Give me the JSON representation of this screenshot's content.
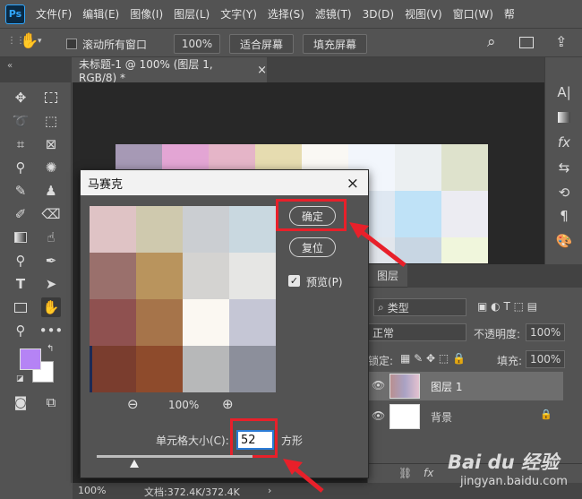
{
  "menubar": {
    "logo": "Ps",
    "items": [
      "文件(F)",
      "编辑(E)",
      "图像(I)",
      "图层(L)",
      "文字(Y)",
      "选择(S)",
      "滤镜(T)",
      "3D(D)",
      "视图(V)",
      "窗口(W)"
    ],
    "overflow": "帮"
  },
  "options": {
    "scroll_all_label": "滚动所有窗口",
    "zoom_value": "100%",
    "fit_screen": "适合屏幕",
    "fill_screen": "填充屏幕"
  },
  "tab": {
    "title": "未标题-1 @ 100% (图层 1, RGB/8) *",
    "close": "×"
  },
  "dialog": {
    "title": "马赛克",
    "close": "×",
    "ok_label": "确定",
    "reset_label": "复位",
    "preview_label": "预览(P)",
    "preview_checked": true,
    "zoom_level": "100%",
    "cell_size_label": "单元格大小(C):",
    "cell_size_value": "52",
    "unit_label": "方形",
    "slider_fraction": 0.24,
    "preview_colors": [
      "#dfc3c5",
      "#cfc9ae",
      "#cbced2",
      "#c9d8e0",
      "#9a706c",
      "#b9945d",
      "#d4d3d1",
      "#e6e6e4",
      "#8f5150",
      "#a6744a",
      "#fbf8f2",
      "#c5c6d5",
      "#7a3d2e",
      "#8e4b2c",
      "#b7b8b9",
      "#8c8f9b"
    ]
  },
  "canvas": {
    "row1_colors": [
      "#a699b5",
      "#e3a5d4",
      "#e5b5c8",
      "#e6dcb0",
      "#faf8f4",
      "#f2f6fc",
      "#ebeff1",
      "#dee2cc"
    ],
    "row2_colors": [
      "#ffffff",
      "#ffffff",
      "#ffffff",
      "#ffffff",
      "#ffffff",
      "#dfe8f2",
      "#bfe2f7",
      "#ececf2"
    ],
    "row3_colors": [
      "#ffffff",
      "#ffffff",
      "#ffffff",
      "#ffffff",
      "#ffffff",
      "#e2e6ec",
      "#c8d6e3",
      "#f0f6dc"
    ]
  },
  "layers": {
    "tab_label": "图层",
    "kind_label": "类型",
    "blend_mode": "正常",
    "opacity_label": "不透明度:",
    "opacity_value": "100%",
    "lock_label": "锁定:",
    "fill_label": "填充:",
    "fill_value": "100%",
    "items": [
      {
        "name": "图层 1",
        "selected": true
      },
      {
        "name": "背景",
        "selected": false
      }
    ]
  },
  "status": {
    "zoom": "100%",
    "doc": "文档:372.4K/372.4K"
  },
  "watermark": {
    "brand": "Bai du 经验",
    "url": "jingyan.baidu.com"
  },
  "colors": {
    "highlight_red": "#e8202a",
    "foreground": "#b583f5",
    "background": "#ffffff"
  }
}
